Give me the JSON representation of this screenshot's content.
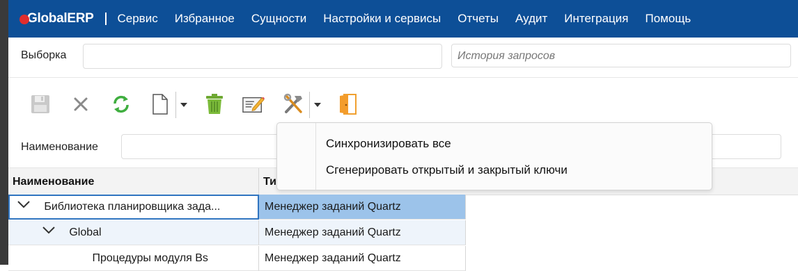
{
  "app": {
    "logo_text_g": "G",
    "logo_text_lobal": "lobal",
    "logo_text_erp": "ERP"
  },
  "nav": {
    "items": [
      "Сервис",
      "Избранное",
      "Сущности",
      "Настройки и сервисы",
      "Отчеты",
      "Аудит",
      "Интеграция",
      "Помощь"
    ]
  },
  "query": {
    "label": "Выборка",
    "value": "",
    "history_placeholder": "История запросов"
  },
  "toolbar": {
    "icons": [
      "save-icon",
      "cancel-icon",
      "refresh-icon",
      "new-document-icon",
      "delete-icon",
      "edit-icon",
      "tools-icon",
      "exit-door-icon"
    ]
  },
  "filter": {
    "label": "Наименование",
    "value": ""
  },
  "grid": {
    "columns": [
      "Наименование",
      "Ти"
    ],
    "rows": [
      {
        "name": "Библиотека планировщика зада...",
        "type": "Менеджер заданий Quartz"
      },
      {
        "name": "Global",
        "type": "Менеджер заданий Quartz"
      },
      {
        "name": "Процедуры модуля Bs",
        "type": "Менеджер заданий Quartz"
      }
    ]
  },
  "menu": {
    "items": [
      "Синхронизировать все",
      "Сгенерировать открытый и закрытый ключи"
    ]
  },
  "colors": {
    "nav_bg": "#0d4f97",
    "selection": "#9cc3ea",
    "accent": "#2f74c0",
    "logo_dot": "#e02d2d"
  }
}
